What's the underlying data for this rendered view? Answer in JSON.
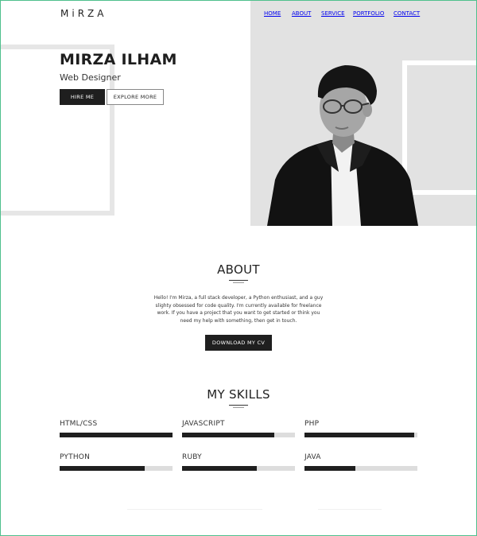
{
  "header": {
    "logo": "MiRZA",
    "nav": [
      {
        "label": "HOME",
        "active": true
      },
      {
        "label": "ABOUT",
        "active": false
      },
      {
        "label": "SERVICE",
        "active": false
      },
      {
        "label": "PORTFOLIO",
        "active": false
      },
      {
        "label": "CONTACT",
        "active": false
      }
    ]
  },
  "hero": {
    "name": "MIRZA ILHAM",
    "role": "Web Designer",
    "hire_button": "HIRE ME",
    "explore_button": "EXPLORE MORE"
  },
  "about": {
    "title": "ABOUT",
    "text": "Hello! I'm Mirza, a full stack developer, a Python enthusiast, and a guy slighty obsessed for code quality. I'm currently available for freelance work. If you have a project that you want to get started or think you need my help with something, then get in touch.",
    "cv_button": "DOWNLOAD MY CV"
  },
  "skills": {
    "title": "MY SKILLS",
    "items": [
      {
        "label": "HTML/CSS",
        "level": 1.0
      },
      {
        "label": "JAVASCRIPT",
        "level": 0.82
      },
      {
        "label": "PHP",
        "level": 0.97
      },
      {
        "label": "PYTHON",
        "level": 0.75
      },
      {
        "label": "RUBY",
        "level": 0.66
      },
      {
        "label": "JAVA",
        "level": 0.45
      }
    ]
  },
  "colors": {
    "accent_dark": "#1f1f1f",
    "hero_panel": "#e2e2e2",
    "frame_border": "#4fc08d"
  }
}
